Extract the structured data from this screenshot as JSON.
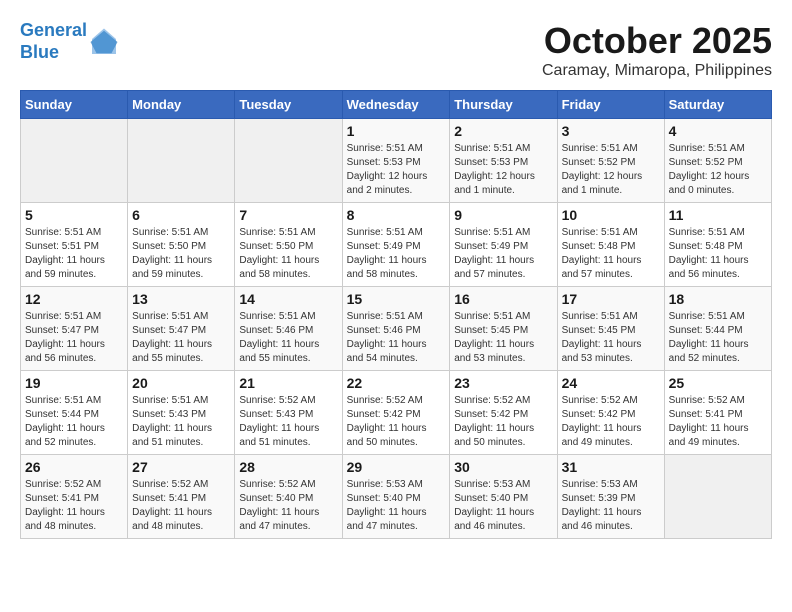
{
  "header": {
    "logo_line1": "General",
    "logo_line2": "Blue",
    "month": "October 2025",
    "location": "Caramay, Mimaropa, Philippines"
  },
  "weekdays": [
    "Sunday",
    "Monday",
    "Tuesday",
    "Wednesday",
    "Thursday",
    "Friday",
    "Saturday"
  ],
  "weeks": [
    [
      {
        "day": "",
        "info": ""
      },
      {
        "day": "",
        "info": ""
      },
      {
        "day": "",
        "info": ""
      },
      {
        "day": "1",
        "info": "Sunrise: 5:51 AM\nSunset: 5:53 PM\nDaylight: 12 hours\nand 2 minutes."
      },
      {
        "day": "2",
        "info": "Sunrise: 5:51 AM\nSunset: 5:53 PM\nDaylight: 12 hours\nand 1 minute."
      },
      {
        "day": "3",
        "info": "Sunrise: 5:51 AM\nSunset: 5:52 PM\nDaylight: 12 hours\nand 1 minute."
      },
      {
        "day": "4",
        "info": "Sunrise: 5:51 AM\nSunset: 5:52 PM\nDaylight: 12 hours\nand 0 minutes."
      }
    ],
    [
      {
        "day": "5",
        "info": "Sunrise: 5:51 AM\nSunset: 5:51 PM\nDaylight: 11 hours\nand 59 minutes."
      },
      {
        "day": "6",
        "info": "Sunrise: 5:51 AM\nSunset: 5:50 PM\nDaylight: 11 hours\nand 59 minutes."
      },
      {
        "day": "7",
        "info": "Sunrise: 5:51 AM\nSunset: 5:50 PM\nDaylight: 11 hours\nand 58 minutes."
      },
      {
        "day": "8",
        "info": "Sunrise: 5:51 AM\nSunset: 5:49 PM\nDaylight: 11 hours\nand 58 minutes."
      },
      {
        "day": "9",
        "info": "Sunrise: 5:51 AM\nSunset: 5:49 PM\nDaylight: 11 hours\nand 57 minutes."
      },
      {
        "day": "10",
        "info": "Sunrise: 5:51 AM\nSunset: 5:48 PM\nDaylight: 11 hours\nand 57 minutes."
      },
      {
        "day": "11",
        "info": "Sunrise: 5:51 AM\nSunset: 5:48 PM\nDaylight: 11 hours\nand 56 minutes."
      }
    ],
    [
      {
        "day": "12",
        "info": "Sunrise: 5:51 AM\nSunset: 5:47 PM\nDaylight: 11 hours\nand 56 minutes."
      },
      {
        "day": "13",
        "info": "Sunrise: 5:51 AM\nSunset: 5:47 PM\nDaylight: 11 hours\nand 55 minutes."
      },
      {
        "day": "14",
        "info": "Sunrise: 5:51 AM\nSunset: 5:46 PM\nDaylight: 11 hours\nand 55 minutes."
      },
      {
        "day": "15",
        "info": "Sunrise: 5:51 AM\nSunset: 5:46 PM\nDaylight: 11 hours\nand 54 minutes."
      },
      {
        "day": "16",
        "info": "Sunrise: 5:51 AM\nSunset: 5:45 PM\nDaylight: 11 hours\nand 53 minutes."
      },
      {
        "day": "17",
        "info": "Sunrise: 5:51 AM\nSunset: 5:45 PM\nDaylight: 11 hours\nand 53 minutes."
      },
      {
        "day": "18",
        "info": "Sunrise: 5:51 AM\nSunset: 5:44 PM\nDaylight: 11 hours\nand 52 minutes."
      }
    ],
    [
      {
        "day": "19",
        "info": "Sunrise: 5:51 AM\nSunset: 5:44 PM\nDaylight: 11 hours\nand 52 minutes."
      },
      {
        "day": "20",
        "info": "Sunrise: 5:51 AM\nSunset: 5:43 PM\nDaylight: 11 hours\nand 51 minutes."
      },
      {
        "day": "21",
        "info": "Sunrise: 5:52 AM\nSunset: 5:43 PM\nDaylight: 11 hours\nand 51 minutes."
      },
      {
        "day": "22",
        "info": "Sunrise: 5:52 AM\nSunset: 5:42 PM\nDaylight: 11 hours\nand 50 minutes."
      },
      {
        "day": "23",
        "info": "Sunrise: 5:52 AM\nSunset: 5:42 PM\nDaylight: 11 hours\nand 50 minutes."
      },
      {
        "day": "24",
        "info": "Sunrise: 5:52 AM\nSunset: 5:42 PM\nDaylight: 11 hours\nand 49 minutes."
      },
      {
        "day": "25",
        "info": "Sunrise: 5:52 AM\nSunset: 5:41 PM\nDaylight: 11 hours\nand 49 minutes."
      }
    ],
    [
      {
        "day": "26",
        "info": "Sunrise: 5:52 AM\nSunset: 5:41 PM\nDaylight: 11 hours\nand 48 minutes."
      },
      {
        "day": "27",
        "info": "Sunrise: 5:52 AM\nSunset: 5:41 PM\nDaylight: 11 hours\nand 48 minutes."
      },
      {
        "day": "28",
        "info": "Sunrise: 5:52 AM\nSunset: 5:40 PM\nDaylight: 11 hours\nand 47 minutes."
      },
      {
        "day": "29",
        "info": "Sunrise: 5:53 AM\nSunset: 5:40 PM\nDaylight: 11 hours\nand 47 minutes."
      },
      {
        "day": "30",
        "info": "Sunrise: 5:53 AM\nSunset: 5:40 PM\nDaylight: 11 hours\nand 46 minutes."
      },
      {
        "day": "31",
        "info": "Sunrise: 5:53 AM\nSunset: 5:39 PM\nDaylight: 11 hours\nand 46 minutes."
      },
      {
        "day": "",
        "info": ""
      }
    ]
  ]
}
